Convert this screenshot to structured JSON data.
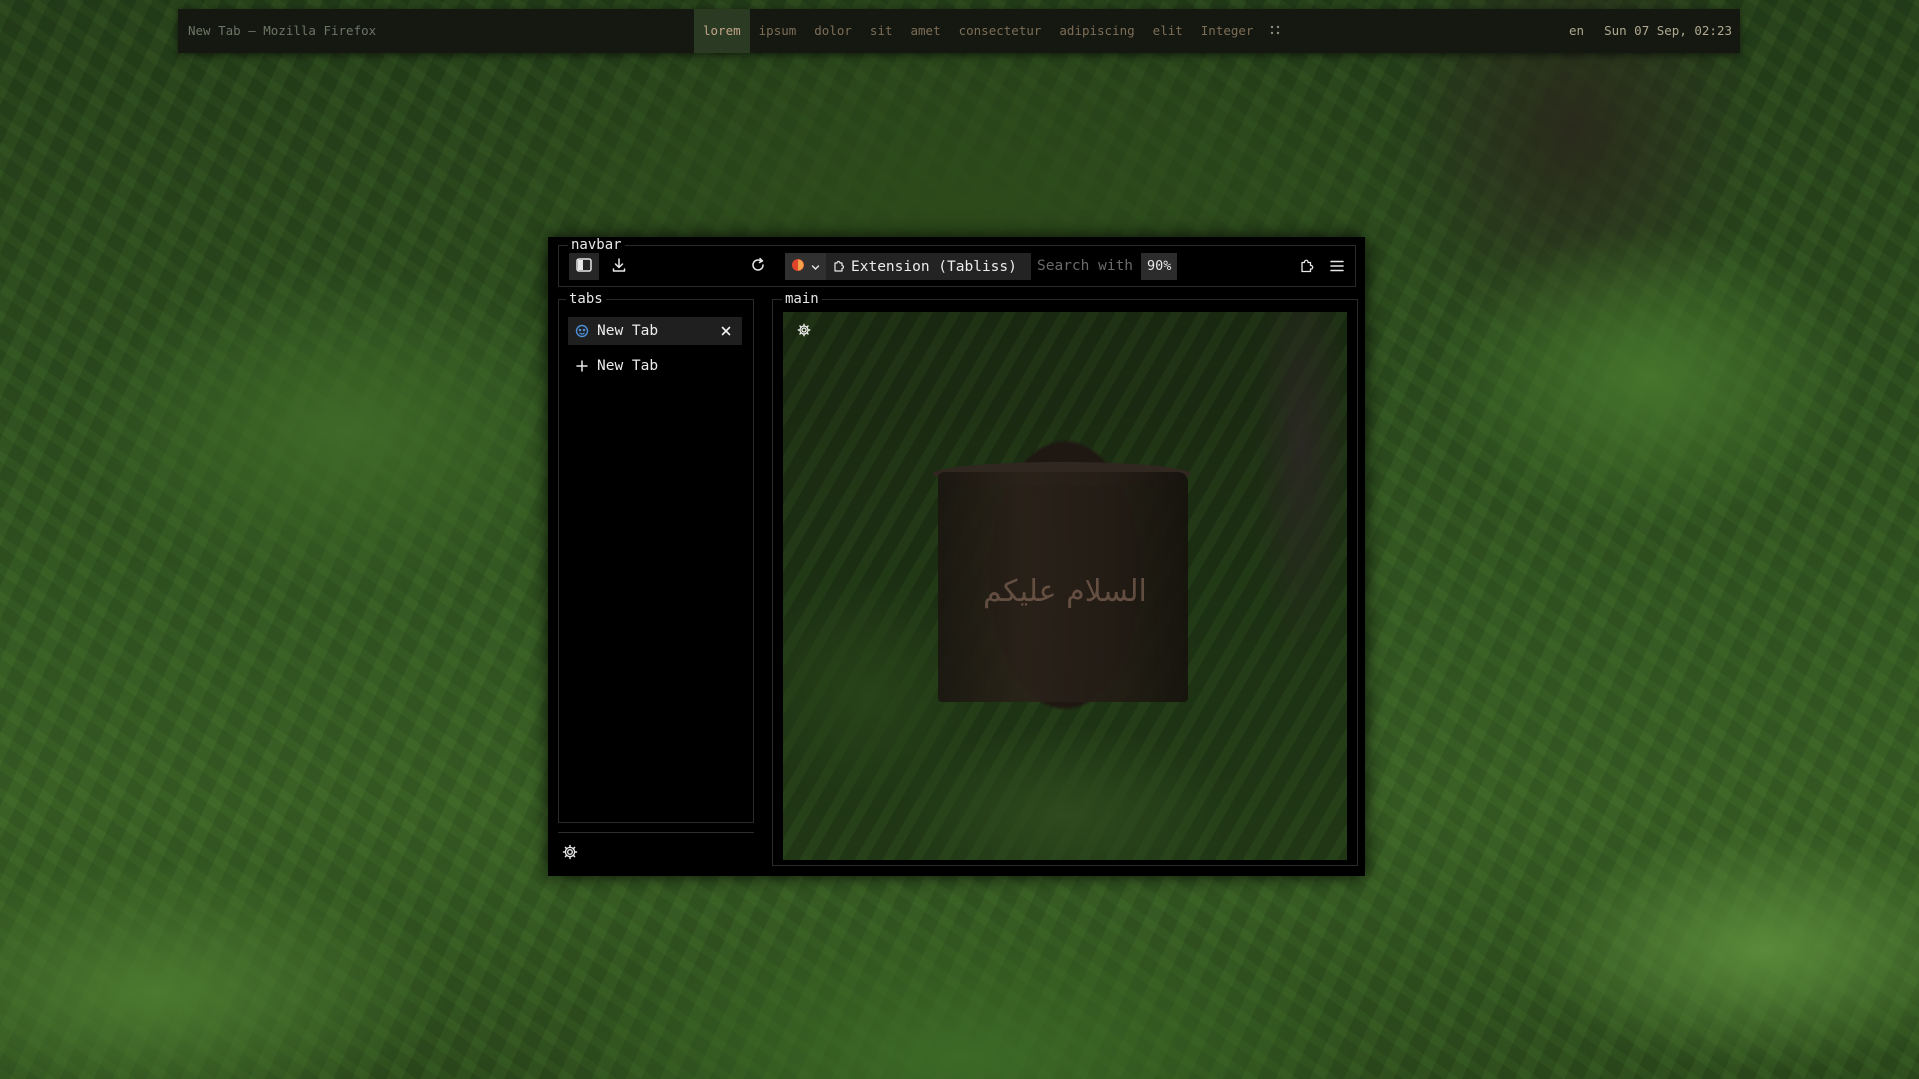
{
  "topbar": {
    "window_title": "New Tab — Mozilla Firefox",
    "workspaces": [
      "lorem",
      "ipsum",
      "dolor",
      "sit",
      "amet",
      "consectetur",
      "adipiscing",
      "elit",
      "Integer"
    ],
    "active_workspace": "lorem",
    "grid_icon": "grid-dots-icon",
    "language": "en",
    "datetime": "Sun 07 Sep, 02:23"
  },
  "browser": {
    "navbar_label": "navbar",
    "tabs_label": "tabs",
    "main_label": "main",
    "urlbar": {
      "identity_icon": "firefox-shield-icon",
      "extension_label": "Extension (Tabliss)",
      "search_placeholder": "Search with",
      "zoom": "90%"
    },
    "tabs": [
      {
        "label": "New Tab",
        "icon": "tabliss-icon",
        "selected": true
      }
    ],
    "new_tab_label": "New Tab",
    "content": {
      "greeting": "السلام عليكم"
    }
  },
  "colors": {
    "accent_workspace_bg": "#2b3a22",
    "accent_workspace_text": "#c2a588",
    "firefox_identity": "#e0452b"
  }
}
